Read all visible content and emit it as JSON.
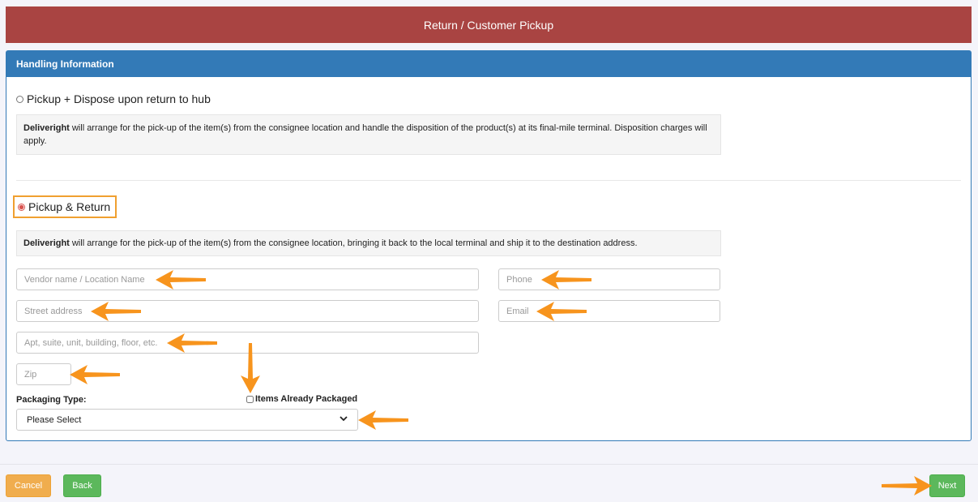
{
  "header": {
    "title": "Return / Customer Pickup"
  },
  "panel": {
    "heading": "Handling Information"
  },
  "options": [
    {
      "label": "Pickup + Dispose upon return to hub",
      "selected": false,
      "desc_brand": "Deliveright",
      "desc_text": "will arrange for the pick-up of the item(s) from the consignee location and handle the disposition of the product(s) at its final-mile terminal. Disposition charges will apply."
    },
    {
      "label": "Pickup & Return",
      "selected": true,
      "desc_brand": "Deliveright",
      "desc_text": "will arrange for the pick-up of the item(s) from the consignee location, bringing it back to the local terminal and ship it to the destination address."
    }
  ],
  "form": {
    "vendor_placeholder": "Vendor name / Location Name",
    "phone_placeholder": "Phone",
    "street_placeholder": "Street address",
    "email_placeholder": "Email",
    "apt_placeholder": "Apt, suite, unit, building, floor, etc.",
    "zip_placeholder": "Zip",
    "packaging_label": "Packaging Type:",
    "packaged_label": "Items Already Packaged",
    "packaging_selected": "Please Select"
  },
  "footer": {
    "cancel_label": "Cancel",
    "back_label": "Back",
    "next_label": "Next"
  },
  "colors": {
    "header": "#a94442",
    "panel": "#337ab7",
    "annotation_arrow": "#f7941d",
    "highlight": "#f0a030"
  }
}
